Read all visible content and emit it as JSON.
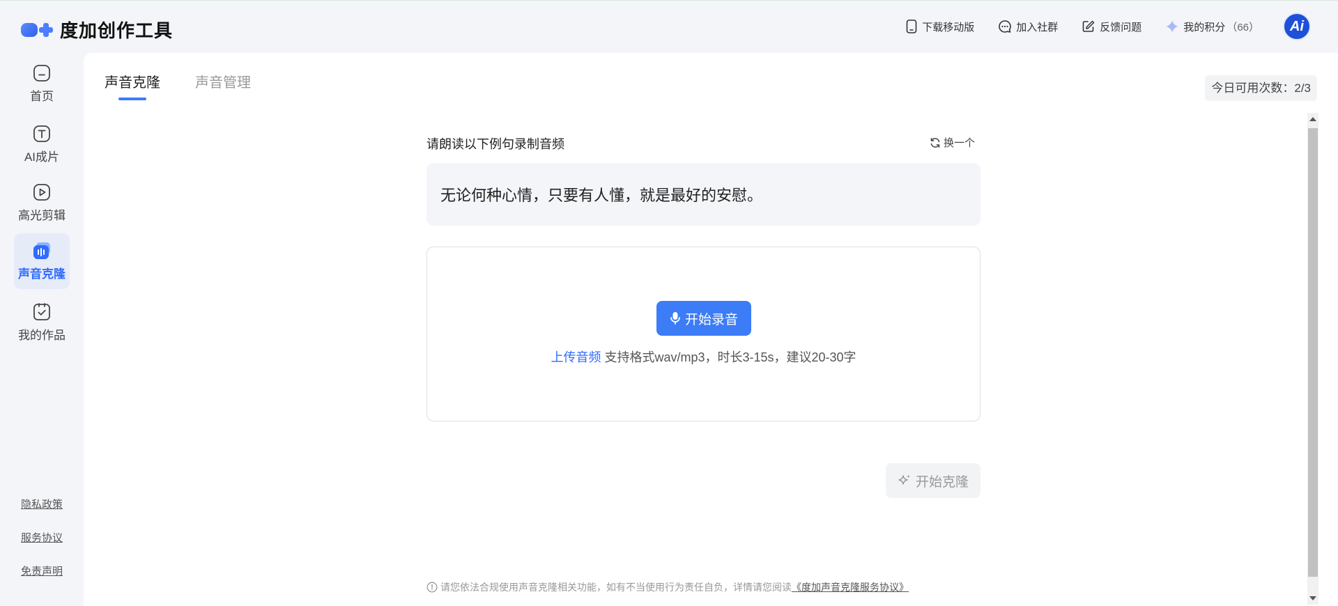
{
  "app": {
    "name": "度加创作工具"
  },
  "header": {
    "actions": [
      {
        "label": "下载移动版",
        "icon": "mobile-icon"
      },
      {
        "label": "加入社群",
        "icon": "chat-icon"
      },
      {
        "label": "反馈问题",
        "icon": "edit-icon"
      },
      {
        "label": "我的积分",
        "icon": "sparkle-icon",
        "count": "（66）"
      }
    ],
    "avatar_text": "Ai"
  },
  "sidebar": {
    "items": [
      {
        "label": "首页",
        "icon": "home-icon"
      },
      {
        "label": "AI成片",
        "icon": "text-icon"
      },
      {
        "label": "高光剪辑",
        "icon": "play-icon"
      },
      {
        "label": "声音克隆",
        "icon": "voice-icon",
        "active": true
      },
      {
        "label": "我的作品",
        "icon": "works-icon"
      }
    ],
    "footer_links": [
      "隐私政策",
      "服务协议",
      "免责声明"
    ]
  },
  "main": {
    "tabs": [
      {
        "label": "声音克隆",
        "active": true
      },
      {
        "label": "声音管理",
        "active": false
      }
    ],
    "quota": "今日可用次数：2/3",
    "prompt_title": "请朗读以下例句录制音频",
    "refresh_label": "换一个",
    "sentence": "无论何种心情，只要有人懂，就是最好的安慰。",
    "record_button": "开始录音",
    "upload_link": "上传音频",
    "upload_hint": " 支持格式wav/mp3，时长3-15s，建议20-30字",
    "clone_button": "开始克隆",
    "disclaimer_text": "请您依法合规使用声音克隆相关功能，如有不当使用行为责任自负，详情请您阅读",
    "disclaimer_link": "《度加声音克隆服务协议》"
  },
  "colors": {
    "accent": "#3c7cf6",
    "active_nav_bg": "#e6ebf8",
    "page_bg": "#f4f5f9"
  }
}
